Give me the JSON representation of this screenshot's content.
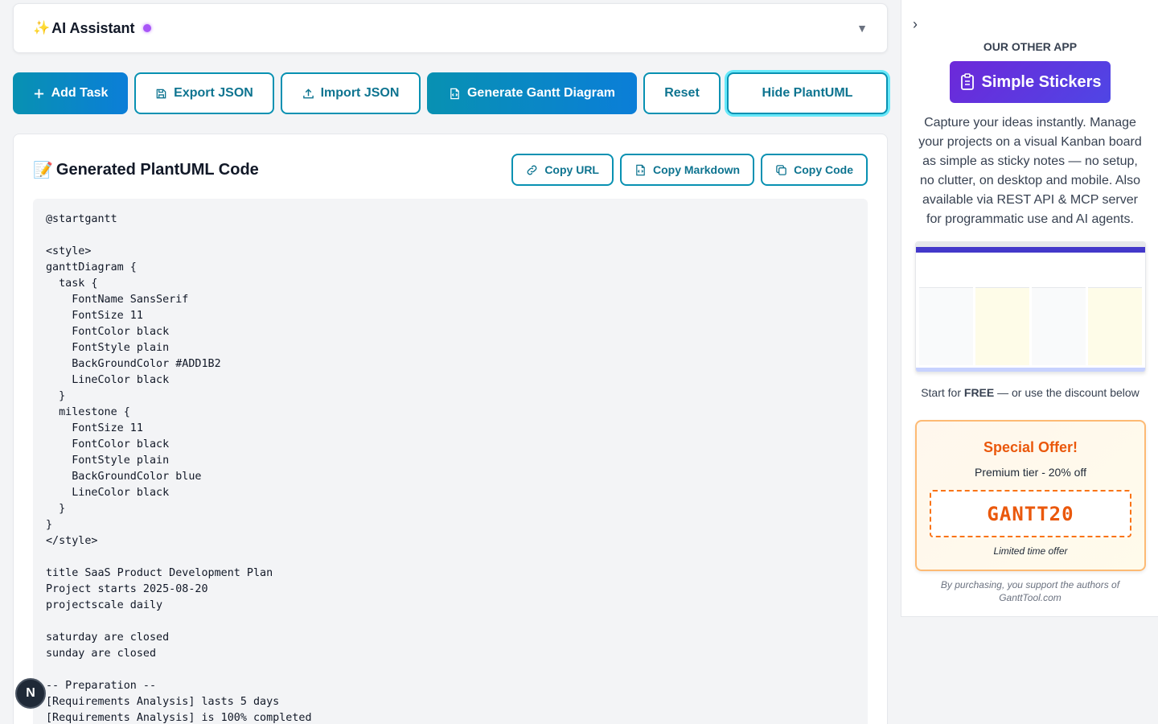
{
  "ai": {
    "sparkle": "✨",
    "title": "AI Assistant",
    "chevron": "▼"
  },
  "toolbar": {
    "add_task": "Add Task",
    "export_json": "Export JSON",
    "import_json": "Import JSON",
    "generate_gantt": "Generate Gantt Diagram",
    "reset": "Reset",
    "hide_plantuml": "Hide PlantUML"
  },
  "code": {
    "emoji": "📝",
    "title": "Generated PlantUML Code",
    "copy_url": "Copy URL",
    "copy_markdown": "Copy Markdown",
    "copy_code": "Copy Code",
    "content": "@startgantt\n\n<style>\nganttDiagram {\n  task {\n    FontName SansSerif\n    FontSize 11\n    FontColor black\n    FontStyle plain\n    BackGroundColor #ADD1B2\n    LineColor black\n  }\n  milestone {\n    FontSize 11\n    FontColor black\n    FontStyle plain\n    BackGroundColor blue\n    LineColor black\n  }\n}\n</style>\n\ntitle SaaS Product Development Plan\nProject starts 2025-08-20\nprojectscale daily\n\nsaturday are closed\nsunday are closed\n\n-- Preparation --\n[Requirements Analysis] lasts 5 days\n[Requirements Analysis] is 100% completed"
  },
  "sidebar": {
    "toggle": "›",
    "heading": "OUR OTHER APP",
    "app_name": "Simple Stickers",
    "description": "Capture your ideas instantly. Manage your projects on a visual Kanban board as simple as sticky notes — no setup, no clutter, on desktop and mobile. Also available via REST API & MCP server for programmatic use and AI agents.",
    "start_prefix": "Start for ",
    "start_bold": "FREE",
    "start_suffix": " — or use the discount below",
    "offer_title": "Special Offer!",
    "offer_sub": "Premium tier - 20% off",
    "coupon": "GANTT20",
    "limited": "Limited time offer",
    "support": "By purchasing, you support the authors of GanttTool.com"
  },
  "next_badge": "N"
}
